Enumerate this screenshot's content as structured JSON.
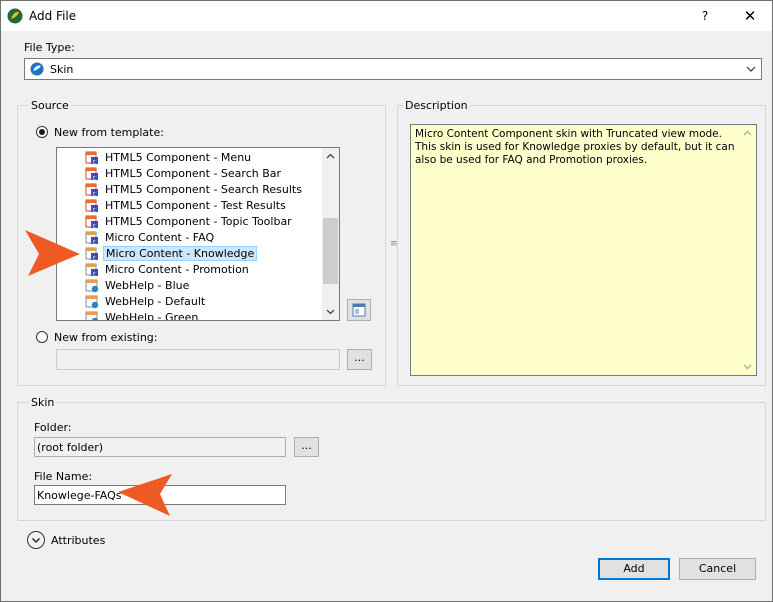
{
  "window": {
    "title": "Add File",
    "help_label": "?",
    "close_label": "✕"
  },
  "file_type": {
    "label": "File Type:",
    "value": "Skin"
  },
  "source": {
    "group_title": "Source",
    "new_from_template_label": "New from template:",
    "template_items": [
      {
        "label": "HTML5 Component - Menu",
        "icon": "component-skin-icon"
      },
      {
        "label": "HTML5 Component - Search Bar",
        "icon": "component-skin-icon"
      },
      {
        "label": "HTML5 Component - Search Results",
        "icon": "component-skin-icon"
      },
      {
        "label": "HTML5 Component - Test Results",
        "icon": "component-skin-icon"
      },
      {
        "label": "HTML5 Component - Topic Toolbar",
        "icon": "component-skin-icon"
      },
      {
        "label": "Micro Content - FAQ",
        "icon": "micro-content-skin-icon"
      },
      {
        "label": "Micro Content - Knowledge",
        "icon": "micro-content-skin-icon",
        "selected": true
      },
      {
        "label": "Micro Content - Promotion",
        "icon": "micro-content-skin-icon"
      },
      {
        "label": "WebHelp - Blue",
        "icon": "webhelp-skin-icon"
      },
      {
        "label": "WebHelp - Default",
        "icon": "webhelp-skin-icon"
      },
      {
        "label": "WebHelp - Green",
        "icon": "webhelp-skin-icon"
      }
    ],
    "new_from_existing_label": "New from existing:",
    "existing_value": "",
    "browse_label": "..."
  },
  "description": {
    "group_title": "Description",
    "text": "Micro Content Component skin with Truncated view mode. This skin is used for Knowledge proxies by default, but it can also be used for FAQ and Promotion proxies."
  },
  "skin": {
    "group_title": "Skin",
    "folder_label": "Folder:",
    "folder_value": "(root folder)",
    "folder_browse_label": "...",
    "file_name_label": "File Name:",
    "file_name_value": "Knowlege-FAQs"
  },
  "attributes": {
    "label": "Attributes"
  },
  "buttons": {
    "add": "Add",
    "cancel": "Cancel"
  },
  "colors": {
    "callout_arrow": "#ee5a24",
    "selection_bg": "#cce8ff",
    "description_bg": "#ffffcc",
    "accent_button_border": "#0078d7"
  }
}
